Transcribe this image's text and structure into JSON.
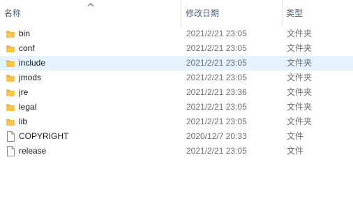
{
  "header": {
    "name_label": "名称",
    "date_label": "修改日期",
    "type_label": "类型",
    "sort_icon": "chevron-up-icon"
  },
  "colors": {
    "hover_row": "#e5f3ff",
    "folder": "#f7c64a",
    "folder_dark": "#e2a93b",
    "header_text": "#4c607a"
  },
  "files": [
    {
      "name": "bin",
      "date": "2021/2/21 23:05",
      "type": "文件夹",
      "icon": "folder-icon"
    },
    {
      "name": "conf",
      "date": "2021/2/21 23:05",
      "type": "文件夹",
      "icon": "folder-icon"
    },
    {
      "name": "include",
      "date": "2021/2/21 23:05",
      "type": "文件夹",
      "icon": "folder-icon",
      "hovered": true
    },
    {
      "name": "jmods",
      "date": "2021/2/21 23:05",
      "type": "文件夹",
      "icon": "folder-icon"
    },
    {
      "name": "jre",
      "date": "2021/2/21 23:36",
      "type": "文件夹",
      "icon": "folder-icon"
    },
    {
      "name": "legal",
      "date": "2021/2/21 23:05",
      "type": "文件夹",
      "icon": "folder-icon"
    },
    {
      "name": "lib",
      "date": "2021/2/21 23:05",
      "type": "文件夹",
      "icon": "folder-icon"
    },
    {
      "name": "COPYRIGHT",
      "date": "2020/12/7 20:33",
      "type": "文件",
      "icon": "file-icon"
    },
    {
      "name": "release",
      "date": "2021/2/21 23:05",
      "type": "文件",
      "icon": "file-icon"
    }
  ]
}
